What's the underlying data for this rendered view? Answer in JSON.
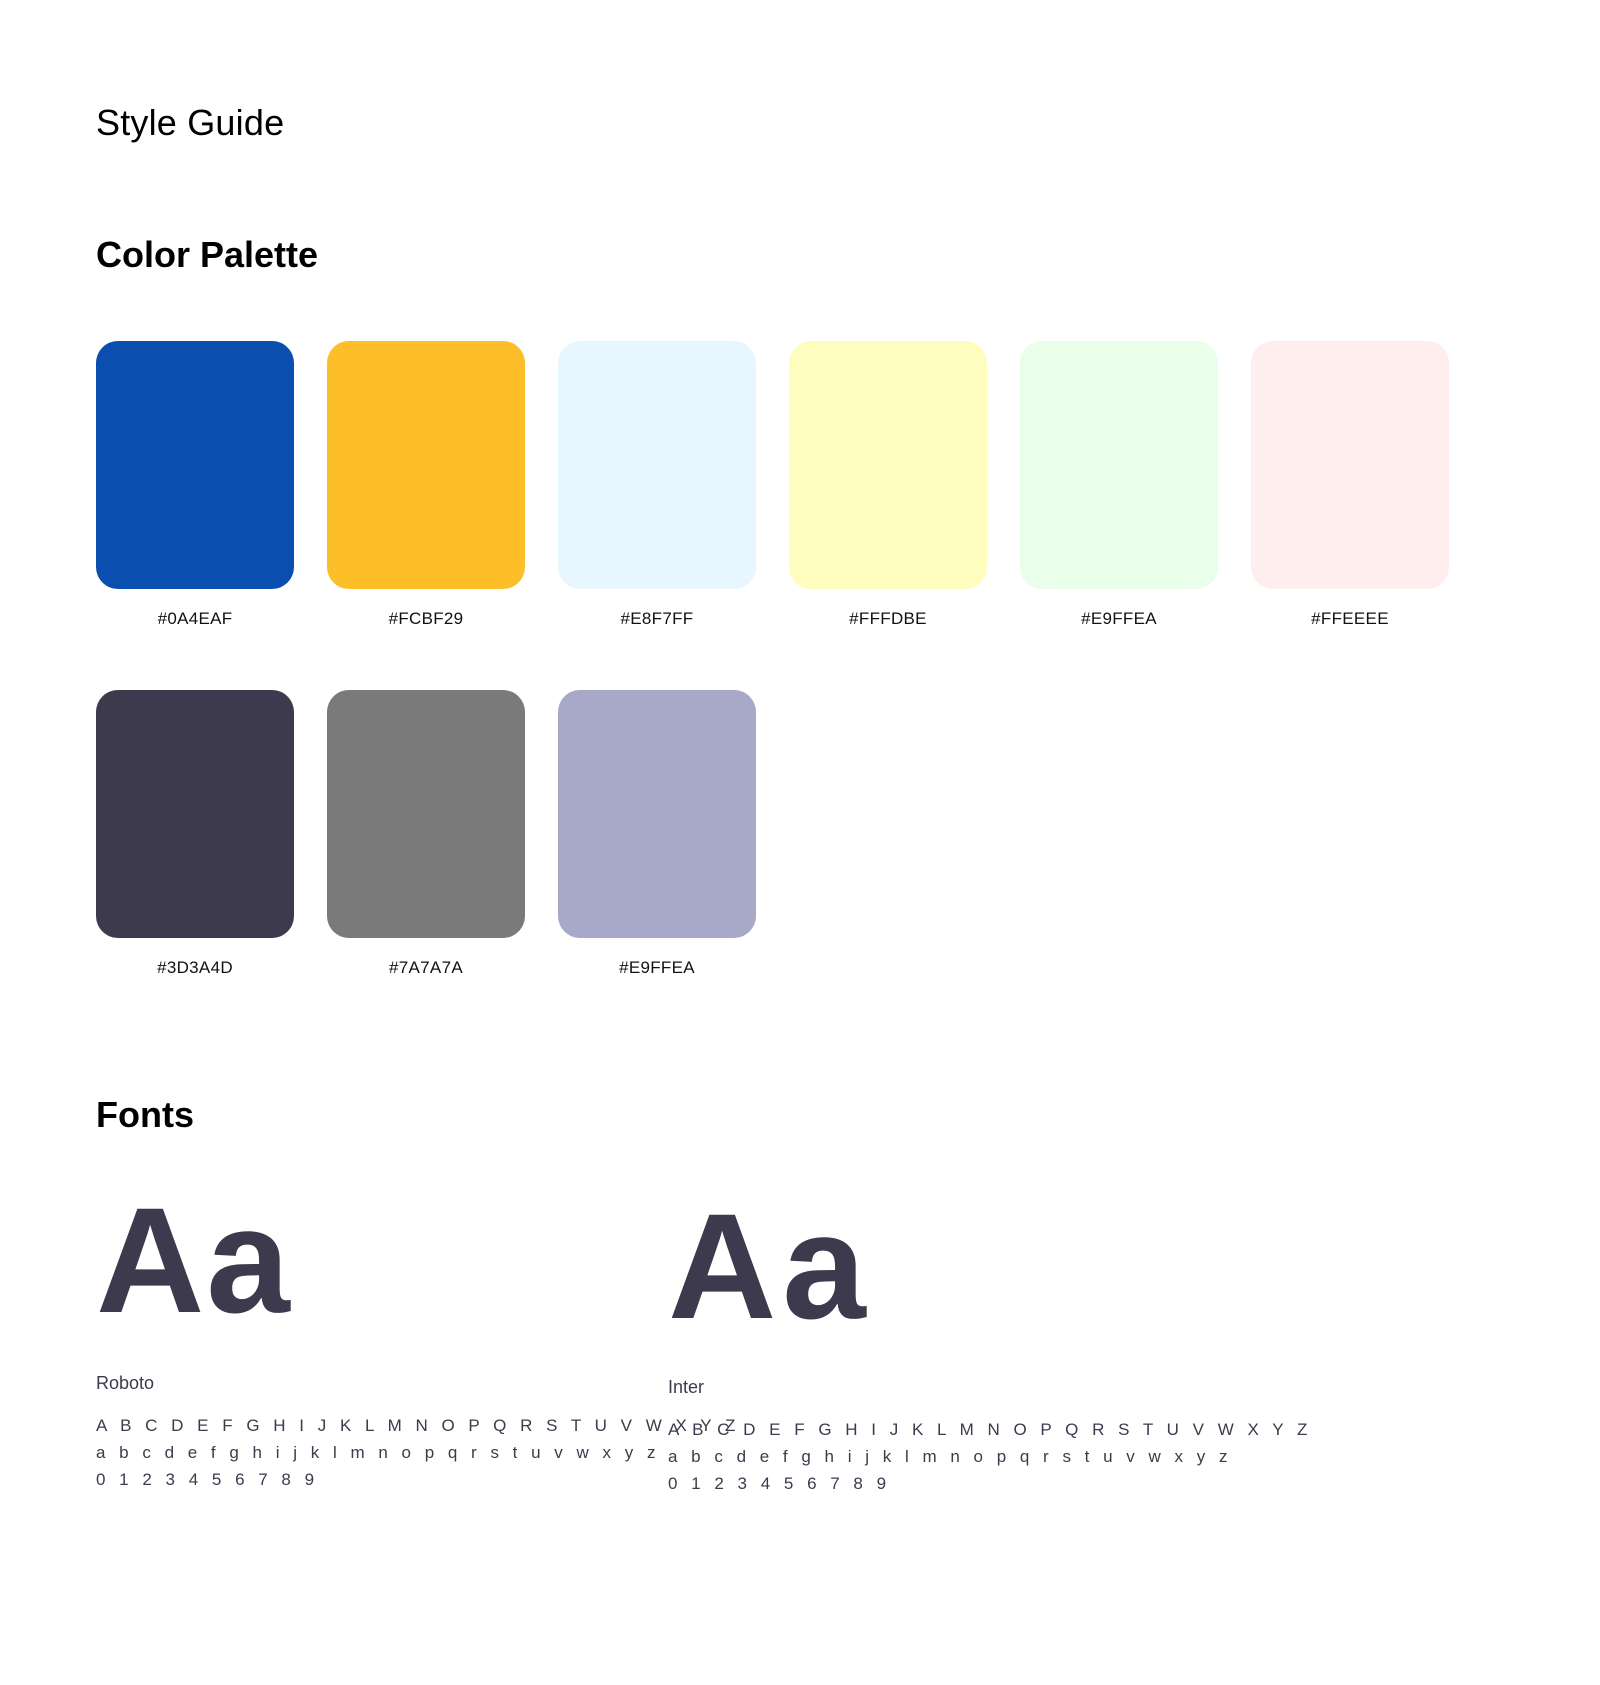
{
  "page": {
    "title": "Style Guide"
  },
  "palette": {
    "heading": "Color Palette",
    "swatches": [
      {
        "label": "#0A4EAF",
        "color": "#0A4EAF"
      },
      {
        "label": "#FCBF29",
        "color": "#FCBF29"
      },
      {
        "label": "#E8F7FF",
        "color": "#E8F7FF"
      },
      {
        "label": "#FFFDBE",
        "color": "#FFFDBE"
      },
      {
        "label": "#E9FFEA",
        "color": "#E9FFEA"
      },
      {
        "label": "#FFEEEE",
        "color": "#FFEEEE"
      },
      {
        "label": "#3D3A4D",
        "color": "#3D3A4D"
      },
      {
        "label": "#7A7A7A",
        "color": "#7A7A7A"
      },
      {
        "label": "#E9FFEA",
        "color": "#A8A9C8"
      }
    ]
  },
  "fonts": {
    "heading": "Fonts",
    "text_color": "#3D3A4D",
    "samples": [
      {
        "glyph": "Aa",
        "name": "Roboto",
        "uppercase": "A B C D E F G H I J K L M N O P Q R S T U V W X Y Z",
        "lowercase": "a b c d e f g h i j k l m n o p q r s t u v w x y z",
        "digits": "0 1 2 3 4 5 6 7 8 9"
      },
      {
        "glyph": "Aa",
        "name": "Inter",
        "uppercase": "A B C D E F G H I J K L M N O P Q R S T U V W X Y Z",
        "lowercase": "a b c d e f g h i j k l m n o p q r s t u v w x y z",
        "digits": "0 1 2 3 4 5 6 7 8 9"
      }
    ]
  }
}
